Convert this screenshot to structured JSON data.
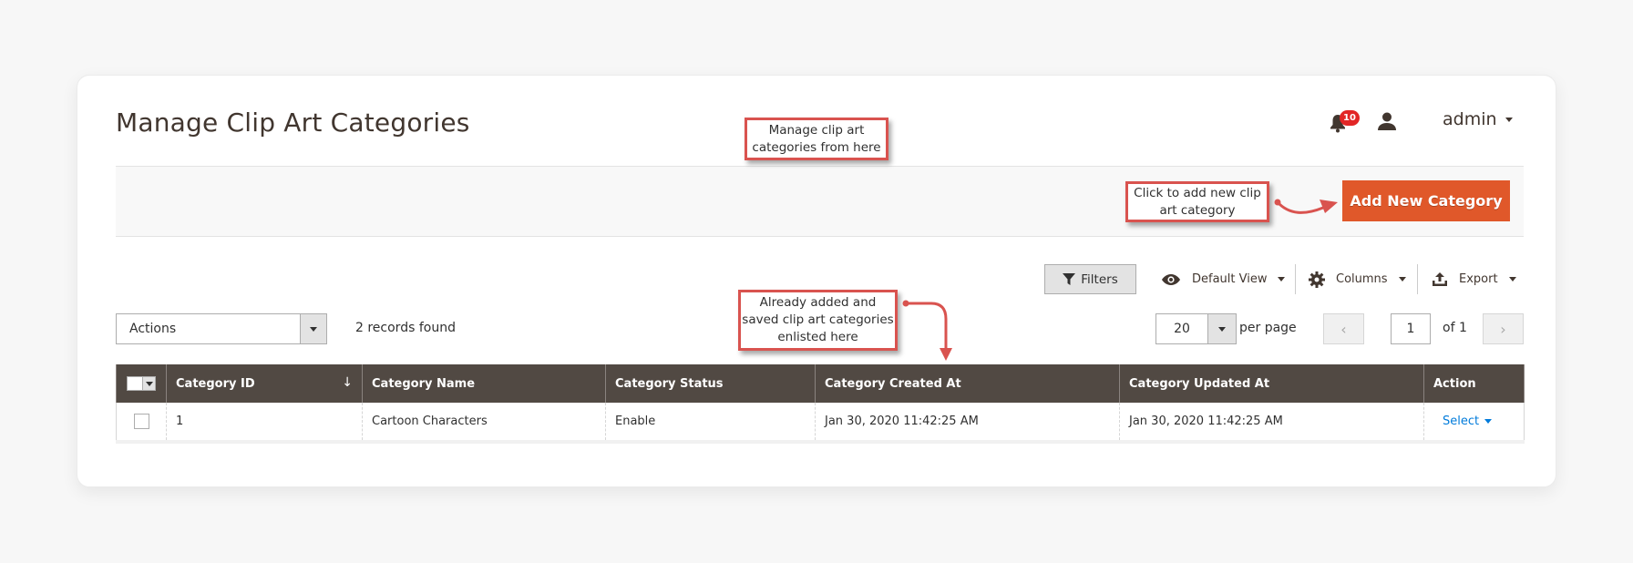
{
  "header": {
    "title": "Manage Clip Art Categories",
    "notifications_count": "10",
    "user_label": "admin"
  },
  "toolbar": {
    "add_button_label": "Add New Category",
    "filters_label": "Filters",
    "view_label": "Default View",
    "columns_label": "Columns",
    "export_label": "Export"
  },
  "grid_controls": {
    "actions_label": "Actions",
    "records_found": "2 records found",
    "per_page_value": "20",
    "per_page_label": "per page",
    "current_page": "1",
    "total_pages_label": "of 1"
  },
  "table": {
    "columns": [
      "Category ID",
      "Category Name",
      "Category Status",
      "Category Created At",
      "Category Updated At",
      "Action"
    ],
    "sort_indicator": "↓",
    "rows": [
      {
        "id": "1",
        "name": "Cartoon Characters",
        "status": "Enable",
        "created_at": "Jan 30, 2020 11:42:25 AM",
        "updated_at": "Jan 30, 2020 11:42:25 AM",
        "action_label": "Select"
      }
    ]
  },
  "annotations": {
    "manage_note": "Manage clip art categories from here",
    "add_note": "Click to add new clip art category",
    "list_note": "Already added and saved clip art categories enlisted here"
  },
  "colors": {
    "accent_button": "#e0582a",
    "table_header": "#514943",
    "link": "#007bdb",
    "annotation_border": "#d9534f",
    "badge": "#e22626"
  }
}
